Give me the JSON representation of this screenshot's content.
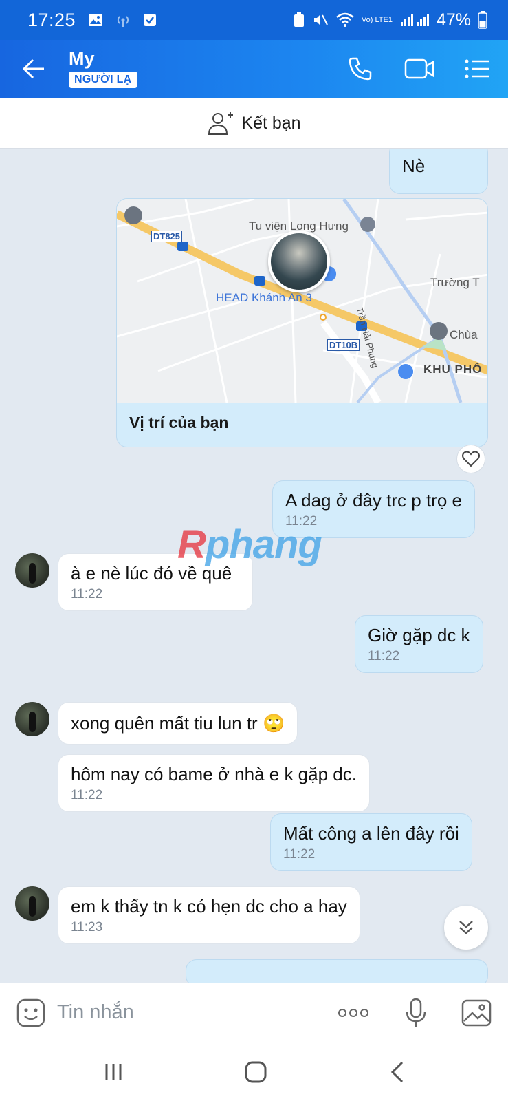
{
  "status_bar": {
    "time": "17:25",
    "battery": "47%",
    "network": "Vo) LTE1"
  },
  "header": {
    "title": "My",
    "badge": "NGƯỜI LẠ"
  },
  "add_friend": {
    "label": "Kết bạn"
  },
  "map": {
    "caption": "Vị trí của bạn",
    "labels": {
      "library": "Tu viện Long Hưng",
      "road1": "DT825",
      "head": "HEAD Khánh An 3",
      "road2": "DT10B",
      "street": "Trần Hải Phụng",
      "school": "Trường T",
      "pagoda": "Chùa",
      "area": "KHU PHỐ"
    }
  },
  "messages": [
    {
      "dir": "out",
      "text": "Nè"
    },
    {
      "dir": "out",
      "text": "A dag ở đây trc p trọ e",
      "time": "11:22"
    },
    {
      "dir": "in",
      "text": "à e nè lúc đó về quê",
      "time": "11:22"
    },
    {
      "dir": "out",
      "text": "Giờ gặp dc k",
      "time": "11:22"
    },
    {
      "dir": "in",
      "text": "xong quên mất tiu lun tr 🙄"
    },
    {
      "dir": "in",
      "text": "hôm nay có bame ở nhà e k gặp dc.",
      "time": "11:22"
    },
    {
      "dir": "out",
      "text": "Mất công a lên đây rồi",
      "time": "11:22"
    },
    {
      "dir": "in",
      "text": "em k thấy tn k có hẹn dc cho a hay",
      "time": "11:23"
    }
  ],
  "watermark": {
    "r": "R",
    "rest": "phang"
  },
  "input": {
    "placeholder": "Tin nhắn"
  },
  "colors": {
    "header": "#1766e0",
    "bubble_out": "#d3ecfb",
    "bubble_in": "#ffffff",
    "chat_bg": "#e2e9f1"
  }
}
